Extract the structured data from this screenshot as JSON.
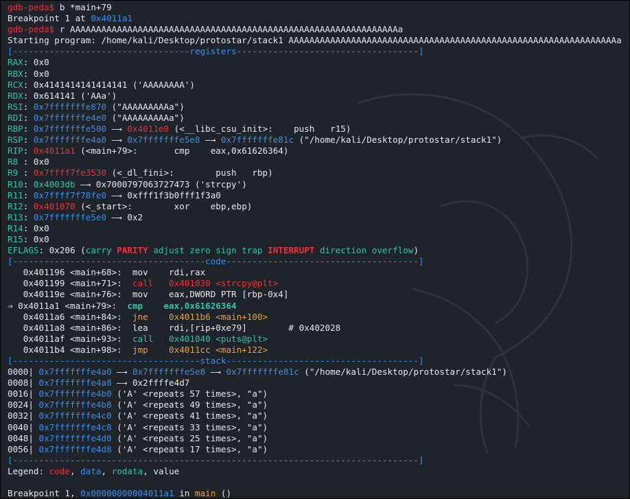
{
  "lines": [
    [
      {
        "t": "gdb-peda$ ",
        "c": "r"
      },
      {
        "t": "b *main+79",
        "c": "w"
      }
    ],
    [
      {
        "t": "Breakpoint 1 at ",
        "c": "w"
      },
      {
        "t": "0x4011a1",
        "c": "b"
      }
    ],
    [
      {
        "t": "gdb-peda$ ",
        "c": "r"
      },
      {
        "t": "r AAAAAAAAAAAAAAAAAAAAAAAAAAAAAAAAAAAAAAAAAAAAAAAAAAAAAAAAAAAAAAAa",
        "c": "w"
      }
    ],
    [
      {
        "t": "Starting program: /home/kali/Desktop/protostar/stack1 AAAAAAAAAAAAAAAAAAAAAAAAAAAAAAAAAAAAAAAAAAAAAAAAAAAAAAAAAAAAAAAa",
        "c": "w"
      }
    ],
    [
      {
        "t": "[----------------------------------registers-----------------------------------]",
        "c": "b"
      }
    ],
    [
      {
        "t": "RAX",
        "c": "g"
      },
      {
        "t": ": 0x0",
        "c": "w"
      }
    ],
    [
      {
        "t": "RBX",
        "c": "g"
      },
      {
        "t": ": 0x0",
        "c": "w"
      }
    ],
    [
      {
        "t": "RCX",
        "c": "g"
      },
      {
        "t": ": 0x4141414141414141 ('AAAAAAAA')",
        "c": "w"
      }
    ],
    [
      {
        "t": "RDX",
        "c": "g"
      },
      {
        "t": ": 0x614141 ('AAa')",
        "c": "w"
      }
    ],
    [
      {
        "t": "RSI",
        "c": "g"
      },
      {
        "t": ": ",
        "c": "w"
      },
      {
        "t": "0x7fffffffe870",
        "c": "b"
      },
      {
        "t": " (\"AAAAAAAAAa\")",
        "c": "w"
      }
    ],
    [
      {
        "t": "RDI",
        "c": "g"
      },
      {
        "t": ": ",
        "c": "w"
      },
      {
        "t": "0x7fffffffe4e0",
        "c": "b"
      },
      {
        "t": " (\"AAAAAAAAAa\")",
        "c": "w"
      }
    ],
    [
      {
        "t": "RBP",
        "c": "g"
      },
      {
        "t": ": ",
        "c": "w"
      },
      {
        "t": "0x7fffffffe500",
        "c": "b"
      },
      {
        "t": " —→ ",
        "c": "w"
      },
      {
        "t": "0x4011e0",
        "c": "r"
      },
      {
        "t": " (<__libc_csu_init>:    push   r15)",
        "c": "w"
      }
    ],
    [
      {
        "t": "RSP",
        "c": "g"
      },
      {
        "t": ": ",
        "c": "w"
      },
      {
        "t": "0x7fffffffe4a0",
        "c": "b"
      },
      {
        "t": " —→ ",
        "c": "w"
      },
      {
        "t": "0x7fffffffe5e8",
        "c": "b"
      },
      {
        "t": " —→ ",
        "c": "w"
      },
      {
        "t": "0x7fffffffe81c",
        "c": "b"
      },
      {
        "t": " (\"/home/kali/Desktop/protostar/stack1\")",
        "c": "w"
      }
    ],
    [
      {
        "t": "RIP",
        "c": "g"
      },
      {
        "t": ": ",
        "c": "w"
      },
      {
        "t": "0x4011a1",
        "c": "r"
      },
      {
        "t": " (<main+79>:       cmp    eax,0x61626364)",
        "c": "w"
      }
    ],
    [
      {
        "t": "R8 ",
        "c": "g"
      },
      {
        "t": ": 0x0",
        "c": "w"
      }
    ],
    [
      {
        "t": "R9 ",
        "c": "g"
      },
      {
        "t": ": ",
        "c": "w"
      },
      {
        "t": "0x7ffff7fe3530",
        "c": "r"
      },
      {
        "t": " (<_dl_fini>:        push   rbp)",
        "c": "w"
      }
    ],
    [
      {
        "t": "R10",
        "c": "g"
      },
      {
        "t": ": ",
        "c": "w"
      },
      {
        "t": "0x4003db",
        "c": "g"
      },
      {
        "t": " —→ 0x7000797063727473 ('strcpy')",
        "c": "w"
      }
    ],
    [
      {
        "t": "R11",
        "c": "g"
      },
      {
        "t": ": ",
        "c": "w"
      },
      {
        "t": "0x7ffff7f78fe0",
        "c": "b"
      },
      {
        "t": " —→ 0xfff1f3b0fff1f3a0",
        "c": "w"
      }
    ],
    [
      {
        "t": "R12",
        "c": "g"
      },
      {
        "t": ": ",
        "c": "w"
      },
      {
        "t": "0x401070",
        "c": "r"
      },
      {
        "t": " (<_start>:        xor    ebp,ebp)",
        "c": "w"
      }
    ],
    [
      {
        "t": "R13",
        "c": "g"
      },
      {
        "t": ": ",
        "c": "w"
      },
      {
        "t": "0x7fffffffe5e0",
        "c": "b"
      },
      {
        "t": " —→ 0x2",
        "c": "w"
      }
    ],
    [
      {
        "t": "R14",
        "c": "g"
      },
      {
        "t": ": 0x0",
        "c": "w"
      }
    ],
    [
      {
        "t": "R15",
        "c": "g"
      },
      {
        "t": ": 0x0",
        "c": "w"
      }
    ],
    [
      {
        "t": "EFLAGS",
        "c": "g"
      },
      {
        "t": ": 0x206 (",
        "c": "w"
      },
      {
        "t": "carry ",
        "c": "g"
      },
      {
        "t": "PARITY",
        "c": "r",
        "b": true
      },
      {
        "t": " adjust zero sign trap ",
        "c": "g"
      },
      {
        "t": "INTERRUPT",
        "c": "r",
        "b": true
      },
      {
        "t": " direction overflow",
        "c": "g"
      },
      {
        "t": ")",
        "c": "w"
      }
    ],
    [
      {
        "t": "[-------------------------------------code-------------------------------------]",
        "c": "b"
      }
    ],
    [
      {
        "t": "   0x401196 <main+68>:  mov    rdi,rax",
        "c": "w"
      }
    ],
    [
      {
        "t": "   0x401199 <main+71>:  ",
        "c": "w"
      },
      {
        "t": "call   0x401030 <strcpy@plt>",
        "c": "r"
      }
    ],
    [
      {
        "t": "   0x40119e <main+76>:  mov    eax,DWORD PTR [rbp-0x4]",
        "c": "w"
      }
    ],
    [
      {
        "t": "⇒ 0x4011a1 <main+79>:  ",
        "c": "w"
      },
      {
        "t": "cmp    eax,0x61626364",
        "c": "g",
        "b": true
      }
    ],
    [
      {
        "t": "   0x4011a6 <main+84>:  ",
        "c": "w"
      },
      {
        "t": "jne    0x4011b6 <main+100>",
        "c": "y"
      }
    ],
    [
      {
        "t": "   0x4011a8 <main+86>:  lea    rdi,[rip+0xe79]        # 0x402028",
        "c": "w"
      }
    ],
    [
      {
        "t": "   0x4011af <main+93>:  ",
        "c": "w"
      },
      {
        "t": "call   0x401040 <puts@plt>",
        "c": "g"
      }
    ],
    [
      {
        "t": "   0x4011b4 <main+98>:  ",
        "c": "w"
      },
      {
        "t": "jmp    0x4011cc <main+122>",
        "c": "y"
      }
    ],
    [
      {
        "t": "[------------------------------------stack-------------------------------------]",
        "c": "b"
      }
    ],
    [
      {
        "t": "0000| ",
        "c": "w"
      },
      {
        "t": "0x7fffffffe4a0",
        "c": "b"
      },
      {
        "t": " —→ ",
        "c": "w"
      },
      {
        "t": "0x7fffffffe5e8",
        "c": "b"
      },
      {
        "t": " —→ ",
        "c": "w"
      },
      {
        "t": "0x7fffffffe81c",
        "c": "b"
      },
      {
        "t": " (\"/home/kali/Desktop/protostar/stack1\")",
        "c": "w"
      }
    ],
    [
      {
        "t": "0008| ",
        "c": "w"
      },
      {
        "t": "0x7fffffffe4a8",
        "c": "b"
      },
      {
        "t": " —→ 0x2ffffe4d7",
        "c": "w"
      }
    ],
    [
      {
        "t": "0016| ",
        "c": "w"
      },
      {
        "t": "0x7fffffffe4b0",
        "c": "b"
      },
      {
        "t": " ('A' <repeats 57 times>, \"a\")",
        "c": "w"
      }
    ],
    [
      {
        "t": "0024| ",
        "c": "w"
      },
      {
        "t": "0x7fffffffe4b8",
        "c": "b"
      },
      {
        "t": " ('A' <repeats 49 times>, \"a\")",
        "c": "w"
      }
    ],
    [
      {
        "t": "0032| ",
        "c": "w"
      },
      {
        "t": "0x7fffffffe4c0",
        "c": "b"
      },
      {
        "t": " ('A' <repeats 41 times>, \"a\")",
        "c": "w"
      }
    ],
    [
      {
        "t": "0040| ",
        "c": "w"
      },
      {
        "t": "0x7fffffffe4c8",
        "c": "b"
      },
      {
        "t": " ('A' <repeats 33 times>, \"a\")",
        "c": "w"
      }
    ],
    [
      {
        "t": "0048| ",
        "c": "w"
      },
      {
        "t": "0x7fffffffe4d0",
        "c": "b"
      },
      {
        "t": " ('A' <repeats 25 times>, \"a\")",
        "c": "w"
      }
    ],
    [
      {
        "t": "0056| ",
        "c": "w"
      },
      {
        "t": "0x7fffffffe4d8",
        "c": "b"
      },
      {
        "t": " ('A' <repeats 17 times>, \"a\")",
        "c": "w"
      }
    ],
    [
      {
        "t": "[------------------------------------------------------------------------------]",
        "c": "b"
      }
    ],
    [
      {
        "t": "Legend: ",
        "c": "w"
      },
      {
        "t": "code",
        "c": "r"
      },
      {
        "t": ", ",
        "c": "w"
      },
      {
        "t": "data",
        "c": "b"
      },
      {
        "t": ", ",
        "c": "w"
      },
      {
        "t": "rodata",
        "c": "g"
      },
      {
        "t": ", value",
        "c": "w"
      }
    ],
    [
      {
        "t": "",
        "c": "w"
      }
    ],
    [
      {
        "t": "Breakpoint 1, ",
        "c": "w"
      },
      {
        "t": "0x00000000004011a1",
        "c": "b"
      },
      {
        "t": " in ",
        "c": "w"
      },
      {
        "t": "main",
        "c": "y"
      },
      {
        "t": " ()",
        "c": "w"
      }
    ]
  ],
  "colors": {
    "background": "#1f232a",
    "red": "#e8323c",
    "blue": "#3a8ee6",
    "green": "#2ec4a4",
    "orange": "#e6a23c",
    "text": "#e8e8e8"
  },
  "background_icon": "kali-dragon-icon"
}
